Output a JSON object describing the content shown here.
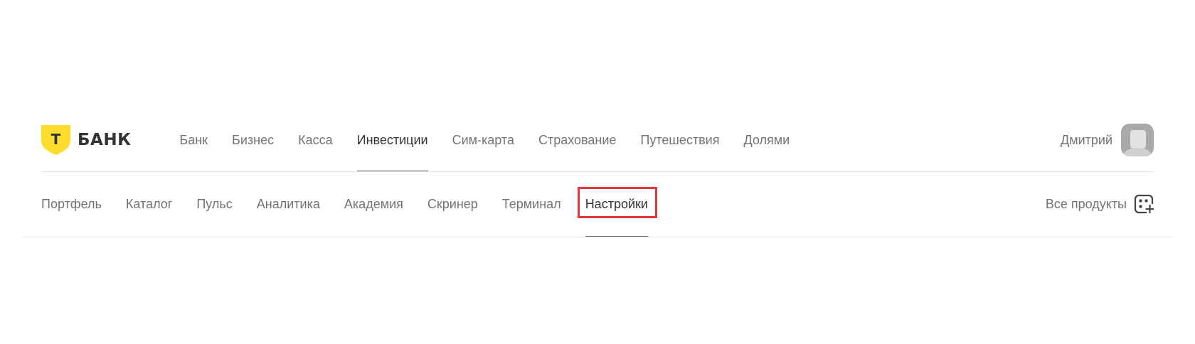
{
  "brand": {
    "name": "БАНК",
    "shield_letter": "Т",
    "shield_color": "#ffdd2d"
  },
  "main_nav": {
    "items": [
      {
        "label": "Банк",
        "active": false
      },
      {
        "label": "Бизнес",
        "active": false
      },
      {
        "label": "Касса",
        "active": false
      },
      {
        "label": "Инвестиции",
        "active": true
      },
      {
        "label": "Сим-карта",
        "active": false
      },
      {
        "label": "Страхование",
        "active": false
      },
      {
        "label": "Путешествия",
        "active": false
      },
      {
        "label": "Долями",
        "active": false
      }
    ]
  },
  "user": {
    "name": "Дмитрий",
    "avatar_icon": "user-avatar-icon"
  },
  "sub_nav": {
    "items": [
      {
        "label": "Портфель",
        "active": false
      },
      {
        "label": "Каталог",
        "active": false
      },
      {
        "label": "Пульс",
        "active": false
      },
      {
        "label": "Аналитика",
        "active": false
      },
      {
        "label": "Академия",
        "active": false
      },
      {
        "label": "Скринер",
        "active": false
      },
      {
        "label": "Терминал",
        "active": false
      },
      {
        "label": "Настройки",
        "active": true,
        "highlighted": true
      }
    ],
    "all_products_label": "Все продукты",
    "all_products_icon": "grid-plus-icon"
  },
  "colors": {
    "highlight": "#e4353b",
    "active_text": "#333333",
    "inactive_text": "#737373"
  }
}
